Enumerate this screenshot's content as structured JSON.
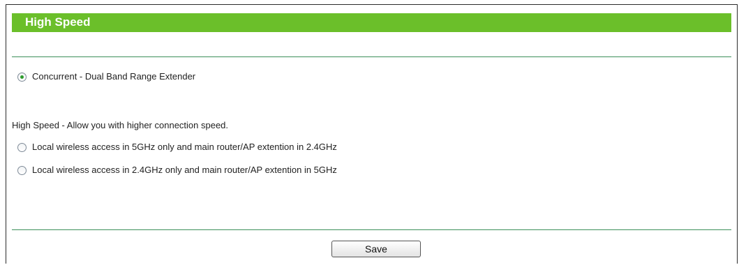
{
  "header": {
    "title": "High Speed"
  },
  "options": {
    "concurrent": {
      "label": "Concurrent - Dual Band Range Extender",
      "checked": true
    },
    "description": "High Speed - Allow you with higher connection speed.",
    "local_5ghz": {
      "label": "Local wireless access in 5GHz only and main router/AP extention in 2.4GHz",
      "checked": false
    },
    "local_24ghz": {
      "label": "Local wireless access in 2.4GHz only and main router/AP extention in 5GHz",
      "checked": false
    }
  },
  "footer": {
    "save_label": "Save"
  },
  "colors": {
    "header_bg": "#6bbf2a",
    "rule": "#3b8f5a",
    "radio_dot": "#2e9c2e"
  }
}
